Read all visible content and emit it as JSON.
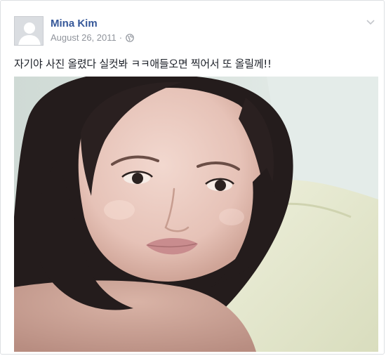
{
  "post": {
    "author": "Mina Kim",
    "date": "August 26, 2011",
    "separator": "·",
    "privacy_icon": "globe-icon",
    "menu_icon": "chevron-down-icon",
    "text": "자기야 사진 올렸다 실컷봐 ㅋㅋ애들오면 찍어서 또 올릴께!!",
    "photo": {
      "subject": "selfie-photo",
      "colors": {
        "pillow": "#e6ead0",
        "sheet": "#dfe8e6",
        "skin": "#e8c7bd",
        "hair": "#241c1c"
      }
    }
  },
  "colors": {
    "author": "#365899",
    "meta": "#90949c",
    "text": "#1d2129",
    "border": "#dddfe2"
  }
}
